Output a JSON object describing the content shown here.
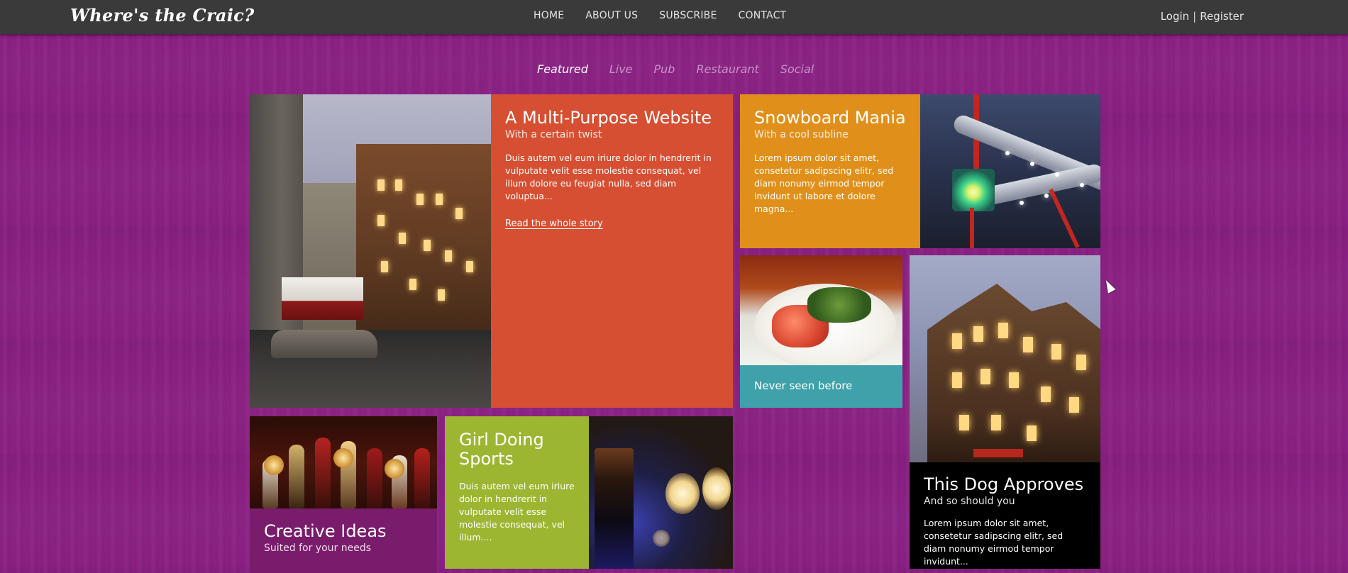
{
  "header": {
    "logo": "Where's the Craic?",
    "nav": [
      "HOME",
      "ABOUT US",
      "SUBSCRIBE",
      "CONTACT"
    ],
    "auth": {
      "login": "Login",
      "separator": "|",
      "register": "Register"
    }
  },
  "filters": {
    "active": "Featured",
    "items": [
      "Featured",
      "Live",
      "Pub",
      "Restaurant",
      "Social"
    ]
  },
  "tiles": {
    "multi": {
      "title": "A Multi-Purpose Website",
      "subtitle": "With a certain twist",
      "body": "Duis autem vel eum iriure dolor in hendrerit in vulputate velit esse molestie consequat, vel illum dolore eu feugiat nulla, sed diam voluptua...",
      "link": "Read the whole story",
      "color": "#d64f32"
    },
    "snowboard": {
      "title": "Snowboard Mania",
      "subtitle": "With a cool subline",
      "body": "Lorem ipsum dolor sit amet, consetetur sadipscing elitr, sed diam nonumy eirmod tempor invidunt ut labore et dolore magna...",
      "color": "#e0901a"
    },
    "never": {
      "title": "Never seen before",
      "color": "#3fa2aa"
    },
    "dog": {
      "title": "This Dog Approves",
      "subtitle": "And so should you",
      "body": "Lorem ipsum dolor sit amet, consetetur sadipscing elitr, sed diam nonumy eirmod tempor invidunt...",
      "color": "#000000"
    },
    "creative": {
      "title": "Creative Ideas",
      "subtitle": "Suited for your needs",
      "color": "#7a1c6c"
    },
    "girl": {
      "title": "Girl Doing Sports",
      "body": "Duis autem vel eum iriure dolor in hendrerit in vulputate velit esse molestie consequat, vel illum....",
      "color": "#9cb632"
    }
  },
  "colors": {
    "background": "#8a2083",
    "topbar": "#3a3a3a",
    "filter_inactive": "#c892c6",
    "filter_active": "#ffffff"
  },
  "images": {
    "street": "dublin-street-night-photo",
    "bigwheel": "illuminated-sculpture-photo",
    "food": "salmon-dish-photo",
    "pub": "oneills-pub-photo",
    "taps": "beer-taps-photo",
    "bokeh": "pint-glass-bokeh-photo"
  }
}
